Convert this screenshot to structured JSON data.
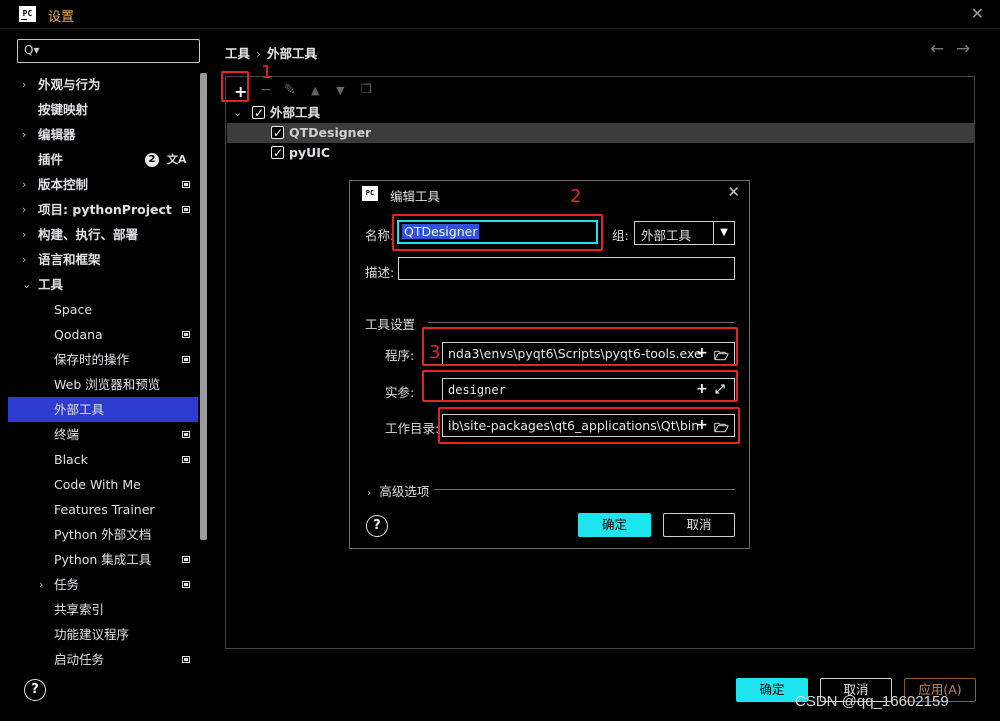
{
  "window": {
    "title": "设置",
    "app_icon": "PC"
  },
  "search": {
    "placeholder": ""
  },
  "sidebar": {
    "items": [
      {
        "label": "外观与行为",
        "arrow": "›",
        "bold": true
      },
      {
        "label": "按键映射",
        "bold": true
      },
      {
        "label": "编辑器",
        "arrow": "›",
        "bold": true
      },
      {
        "label": "插件",
        "bold": true,
        "badge": "2"
      },
      {
        "label": "版本控制",
        "arrow": "›",
        "bold": true
      },
      {
        "label": "项目: pythonProject",
        "arrow": "›",
        "bold": true
      },
      {
        "label": "构建、执行、部署",
        "arrow": "›",
        "bold": true
      },
      {
        "label": "语言和框架",
        "arrow": "›",
        "bold": true
      },
      {
        "label": "工具",
        "arrow": "⌄",
        "bold": true
      },
      {
        "label": "Space"
      },
      {
        "label": "Qodana"
      },
      {
        "label": "保存时的操作"
      },
      {
        "label": "Web 浏览器和预览"
      },
      {
        "label": "外部工具",
        "selected": true
      },
      {
        "label": "终端"
      },
      {
        "label": "Black"
      },
      {
        "label": "Code With Me"
      },
      {
        "label": "Features Trainer"
      },
      {
        "label": "Python 外部文档"
      },
      {
        "label": "Python 集成工具"
      },
      {
        "label": "任务",
        "arrow": "›"
      },
      {
        "label": "共享索引"
      },
      {
        "label": "功能建议程序"
      },
      {
        "label": "启动任务"
      }
    ]
  },
  "breadcrumb": {
    "parent": "工具",
    "current": "外部工具"
  },
  "tree": {
    "group": "外部工具",
    "items": [
      "QTDesigner",
      "pyUIC"
    ]
  },
  "annotations": {
    "n1": "1",
    "n2": "2",
    "n3": "3"
  },
  "dialog": {
    "title": "编辑工具",
    "name_label": "名称:",
    "name_value": "QTDesigner",
    "group_label": "组:",
    "group_value": "外部工具",
    "desc_label": "描述:",
    "desc_value": "",
    "section_label": "工具设置",
    "program_label": "程序:",
    "program_value": "nda3\\envs\\pyqt6\\Scripts\\pyqt6-tools.exe",
    "args_label": "实参:",
    "args_value": "designer",
    "workdir_label": "工作目录:",
    "workdir_value": "ib\\site-packages\\qt6_applications\\Qt\\bin",
    "advanced_label": "高级选项",
    "ok_label": "确定",
    "cancel_label": "取消"
  },
  "footer": {
    "ok_label": "确定",
    "cancel_label": "取消",
    "apply_label": "应用(A)"
  },
  "watermark": "CSDN @qq_16602159",
  "colors": {
    "accent": "#1ee4ee",
    "selection": "#2e3bd1",
    "annotation": "#e2261f",
    "title": "#e7b04a"
  }
}
